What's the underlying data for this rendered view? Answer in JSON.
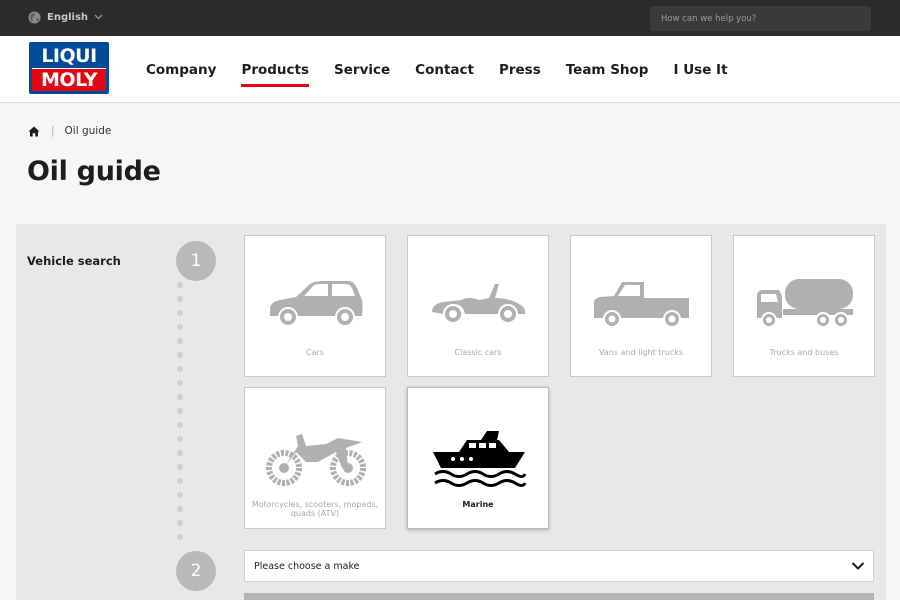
{
  "topbar": {
    "language": "English",
    "search_placeholder": "How can we help you?"
  },
  "logo": {
    "line1": "LIQUI",
    "line2": "MOLY"
  },
  "nav": {
    "items": [
      "Company",
      "Products",
      "Service",
      "Contact",
      "Press",
      "Team Shop",
      "I Use It"
    ],
    "active": "Products"
  },
  "breadcrumb": {
    "current": "Oil guide"
  },
  "page_title": "Oil guide",
  "vehicle_search": {
    "label": "Vehicle search",
    "steps": [
      "1",
      "2"
    ],
    "categories": [
      {
        "label": "Cars",
        "icon": "car-icon",
        "selected": false
      },
      {
        "label": "Classic cars",
        "icon": "classic-car-icon",
        "selected": false
      },
      {
        "label": "Vans and light trucks",
        "icon": "pickup-truck-icon",
        "selected": false
      },
      {
        "label": "Trucks and buses",
        "icon": "tanker-truck-icon",
        "selected": false
      },
      {
        "label": "Motorcycles, scooters, mopeds, quads (ATV)",
        "icon": "motorcycle-icon",
        "selected": false
      },
      {
        "label": "Marine",
        "icon": "boat-icon",
        "selected": true
      }
    ],
    "make_placeholder": "Please choose a make"
  },
  "colors": {
    "topbar_bg": "#2b2b2b",
    "brand_blue": "#004a99",
    "brand_red": "#e30613",
    "inactive_icon": "#b0b0b0",
    "active_icon": "#000000"
  }
}
